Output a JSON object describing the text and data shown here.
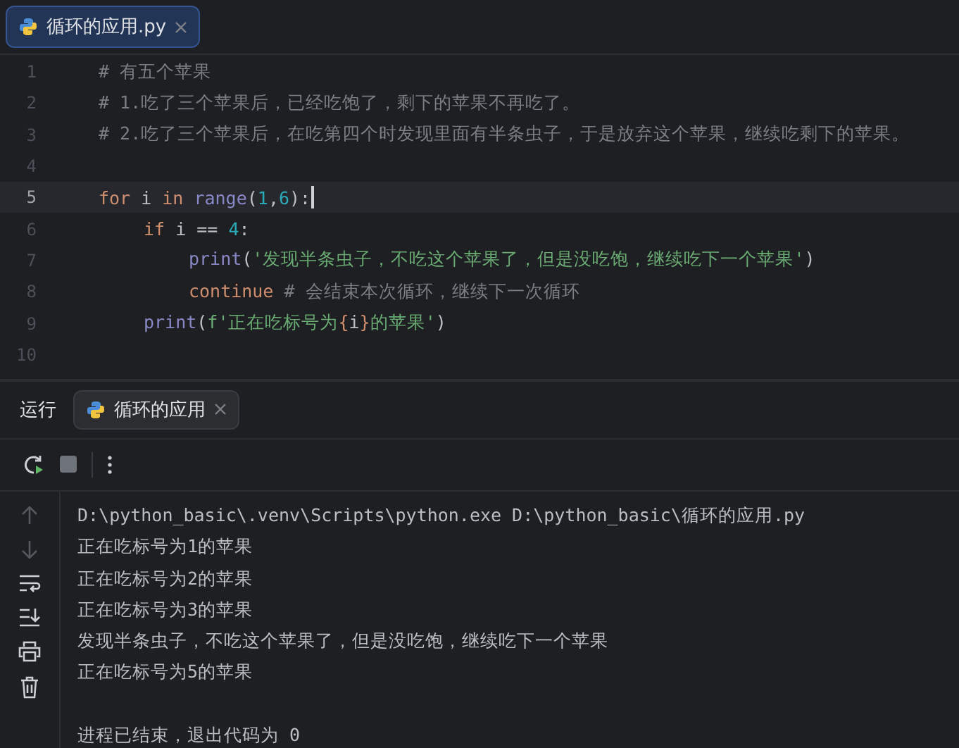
{
  "editor_tab": {
    "label": "循环的应用.py",
    "selected": true
  },
  "code_lines": [
    {
      "number": "1",
      "current": false,
      "tokens": [
        {
          "kind": "comment",
          "text": "# 有五个苹果"
        }
      ]
    },
    {
      "number": "2",
      "current": false,
      "tokens": [
        {
          "kind": "comment",
          "text": "# 1.吃了三个苹果后，已经吃饱了，剩下的苹果不再吃了。"
        }
      ]
    },
    {
      "number": "3",
      "current": false,
      "tokens": [
        {
          "kind": "comment",
          "text": "# 2.吃了三个苹果后，在吃第四个时发现里面有半条虫子，于是放弃这个苹果，继续吃剩下的苹果。"
        }
      ]
    },
    {
      "number": "4",
      "current": false
    },
    {
      "number": "5",
      "current": true,
      "tokens": [
        {
          "kind": "keyword",
          "text": "for"
        },
        {
          "kind": "plain",
          "text": " i "
        },
        {
          "kind": "keyword",
          "text": "in "
        },
        {
          "kind": "builtin",
          "text": "range"
        },
        {
          "kind": "plain",
          "text": "("
        },
        {
          "kind": "number",
          "text": "1"
        },
        {
          "kind": "plain",
          "text": ","
        },
        {
          "kind": "number",
          "text": "6"
        },
        {
          "kind": "plain",
          "text": "):"
        }
      ],
      "children": [
        {
          "number": "6",
          "current": false,
          "tokens": [
            {
              "kind": "keyword",
              "text": "if"
            },
            {
              "kind": "plain",
              "text": " i == "
            },
            {
              "kind": "number",
              "text": "4"
            },
            {
              "kind": "plain",
              "text": ":"
            }
          ],
          "children": [
            {
              "number": "7",
              "current": false,
              "tokens": [
                {
                  "kind": "builtin",
                  "text": "print"
                },
                {
                  "kind": "plain",
                  "text": "("
                },
                {
                  "kind": "string",
                  "text": "'发现半条虫子，不吃这个苹果了，但是没吃饱，继续吃下一个苹果'"
                },
                {
                  "kind": "plain",
                  "text": ")"
                }
              ]
            },
            {
              "number": "8",
              "current": false,
              "tokens": [
                {
                  "kind": "keyword",
                  "text": "continue"
                },
                {
                  "kind": "comment",
                  "text": " # 会结束本次循环，继续下一次循环"
                }
              ]
            }
          ]
        },
        {
          "number": "9",
          "current": false,
          "tokens": [
            {
              "kind": "builtin",
              "text": "print"
            },
            {
              "kind": "plain",
              "text": "("
            },
            {
              "kind": "string",
              "text": "f'正在吃标号为"
            },
            {
              "kind": "brace",
              "text": "{"
            },
            {
              "kind": "plain",
              "text": "i"
            },
            {
              "kind": "brace",
              "text": "}"
            },
            {
              "kind": "string",
              "text": "的苹果'"
            },
            {
              "kind": "plain",
              "text": ")"
            }
          ]
        }
      ]
    },
    {
      "number": "10",
      "current": false
    }
  ],
  "run_panel": {
    "title": "运行",
    "tabs": [
      {
        "label": "循环的应用",
        "selected": true
      }
    ],
    "output_lines": [
      "D:\\python_basic\\.venv\\Scripts\\python.exe D:\\python_basic\\循环的应用.py",
      "正在吃标号为1的苹果",
      "正在吃标号为2的苹果",
      "正在吃标号为3的苹果",
      "发现半条虫子，不吃这个苹果了，但是没吃饱，继续吃下一个苹果",
      "正在吃标号为5的苹果"
    ],
    "exit_message": "进程已结束，退出代码为 0"
  }
}
